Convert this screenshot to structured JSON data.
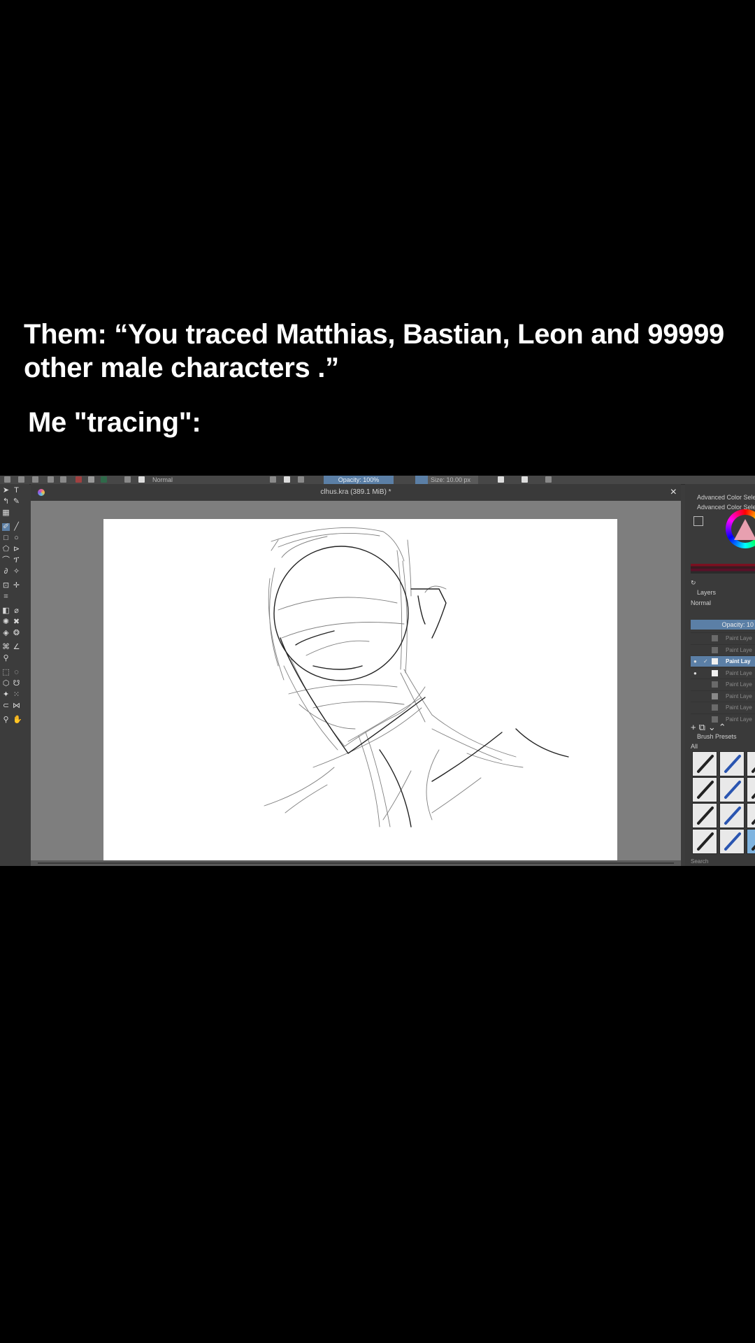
{
  "caption": {
    "line1": "Them: “You traced Matthias, Bastian, Leon and 99999 other male characters .”",
    "line2": "Me \"tracing\":"
  },
  "toolbar": {
    "blend_mode": "Normal",
    "opacity": "Opacity: 100%",
    "size": "Size: 10.00 px"
  },
  "document": {
    "title": "clhus.kra (389.1 MiB) *",
    "close_icon": "×"
  },
  "dock": {
    "advanced_color_title": "Advanced Color Select",
    "advanced_color_sub": "Advanced Color Selec",
    "layers_title": "Layers",
    "layers_blend": "Normal",
    "layers_opacity": "Opacity: 10",
    "layers": [
      {
        "name": "Paint Laye",
        "active": false,
        "visible": false,
        "thumb": "#6a6a6a"
      },
      {
        "name": "Paint Laye",
        "active": false,
        "visible": false,
        "thumb": "#6a6a6a"
      },
      {
        "name": "Paint Lay",
        "active": true,
        "visible": true,
        "thumb": "#f0f0f0"
      },
      {
        "name": "Paint Laye",
        "active": false,
        "visible": true,
        "thumb": "#f0f0f0"
      },
      {
        "name": "Paint Laye",
        "active": false,
        "visible": false,
        "thumb": "#6a6a6a"
      },
      {
        "name": "Paint Laye",
        "active": false,
        "visible": false,
        "thumb": "#888888"
      },
      {
        "name": "Paint Laye",
        "active": false,
        "visible": false,
        "thumb": "#6a6a6a"
      },
      {
        "name": "Paint Laye",
        "active": false,
        "visible": false,
        "thumb": "#6a6a6a"
      }
    ],
    "brush_presets_title": "Brush Presets",
    "brush_filter": "All",
    "search_label": "Search"
  },
  "colors": {
    "accent": "#5b7fa6",
    "panel": "#3c3c3c",
    "canvas": "#ffffff"
  }
}
